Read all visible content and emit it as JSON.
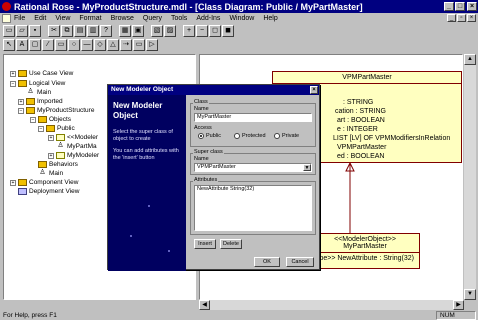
{
  "window": {
    "title": "Rational Rose - MyProductStructure.mdl - [Class Diagram: Public / MyPartMaster]",
    "minimize": "_",
    "maximize": "□",
    "close": "×"
  },
  "menu": {
    "items": [
      "File",
      "Edit",
      "View",
      "Format",
      "Browse",
      "Query",
      "Tools",
      "Add-Ins",
      "Window",
      "Help"
    ]
  },
  "toolbar1": {
    "buttons": [
      "new-icon",
      "open-icon",
      "save-icon",
      "cut-icon",
      "copy-icon",
      "paste-icon",
      "print-icon",
      "help-icon",
      "browse-icon",
      "class-diagram-icon",
      "component-icon",
      "deploy-icon",
      "zoom-in-icon",
      "zoom-out-icon",
      "fit-icon",
      "undo-fit-icon"
    ]
  },
  "toolbar2": {
    "buttons": [
      "select-icon",
      "text-icon",
      "note-icon",
      "anchor-icon",
      "class-icon",
      "interface-icon",
      "association-icon",
      "aggregation-icon",
      "generalize-icon",
      "dependency-icon",
      "package-icon",
      "realize-icon"
    ]
  },
  "tree": {
    "items": [
      {
        "label": "Use Case View",
        "type": "folder",
        "exp": "+"
      },
      {
        "label": "Logical View",
        "type": "folder",
        "exp": "−"
      },
      {
        "label": "Main",
        "type": "actor",
        "exp": ""
      },
      {
        "label": "Imported",
        "type": "folder",
        "exp": "+"
      },
      {
        "label": "MyProductStructure",
        "type": "folder",
        "exp": "−"
      },
      {
        "label": "Objects",
        "type": "folder",
        "exp": "−"
      },
      {
        "label": "Public",
        "type": "folder",
        "exp": "−"
      },
      {
        "label": "<<Modeler",
        "type": "class",
        "exp": "+"
      },
      {
        "label": "MyPartMa",
        "type": "actor",
        "exp": ""
      },
      {
        "label": "MyModeler",
        "type": "class",
        "exp": "+"
      },
      {
        "label": "Behaviors",
        "type": "folder",
        "exp": ""
      },
      {
        "label": "Main",
        "type": "actor",
        "exp": ""
      },
      {
        "label": "Component View",
        "type": "folder",
        "exp": "+"
      },
      {
        "label": "Deployment View",
        "type": "cmp",
        "exp": ""
      }
    ]
  },
  "diagram": {
    "class1": {
      "name": "VPMPartMaster",
      "attributes": [
        ": STRING",
        "cation : STRING",
        "art : BOOLEAN",
        "e : INTEGER",
        "LIST [LV] OF VPMModifiersInRelation",
        "VPMPartMaster",
        "ed : BOOLEAN"
      ]
    },
    "class2": {
      "stereotype": "<<ModelerObject>>",
      "name": "MyPartMaster",
      "attribute": "type>> NewAttribute : String(32)"
    }
  },
  "dialog": {
    "title": "New Modeler Object",
    "close": "×",
    "wizard_title": "New Modeler Object",
    "wizard_text1": "Select the super class of object to create",
    "wizard_text2": "You can add attributes with the 'insert' button",
    "class_group": "Class",
    "name_label": "Name",
    "name_value": "MyPartMaster",
    "access_label": "Access",
    "access_options": [
      "Public",
      "Protected",
      "Private"
    ],
    "superclass_group": "Super class",
    "superclass_name_label": "Name",
    "superclass_value": "VPMPartMaster",
    "attributes_group": "Attributes",
    "attribute_value": "NewAttribute String(32)",
    "insert_button": "Insert",
    "delete_button": "Delete",
    "ok_button": "OK",
    "cancel_button": "Cancel"
  },
  "status": {
    "message": "For Help, press F1",
    "num": "NUM"
  }
}
